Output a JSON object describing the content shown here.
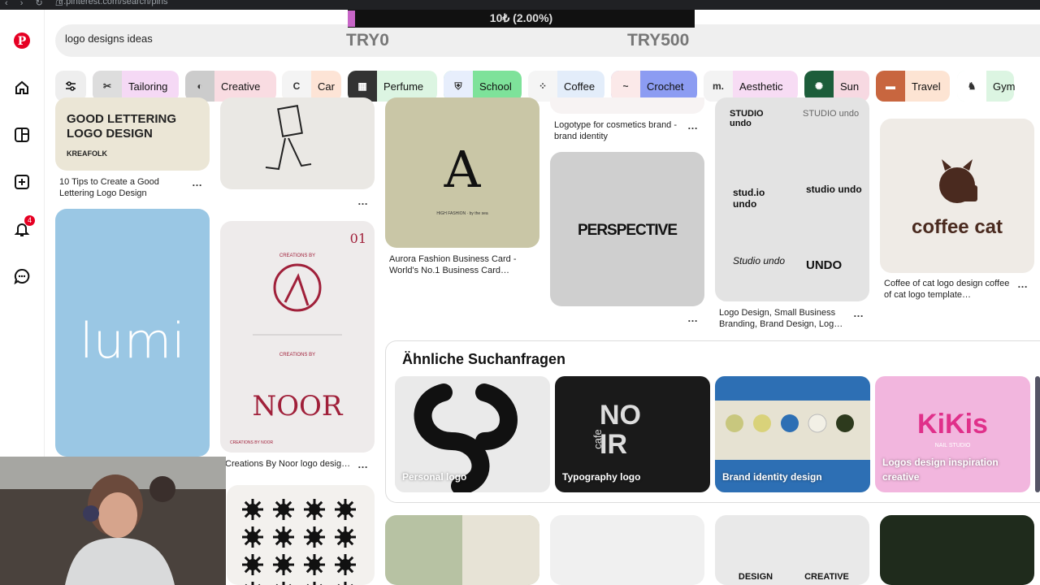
{
  "browser": {
    "url": "tr.pinterest.com/search/pins",
    "nav": "‹ › ↻ ☖"
  },
  "sidebar": {
    "items": [
      {
        "icon": "pinterest-logo-icon"
      },
      {
        "icon": "home-icon"
      },
      {
        "icon": "boards-icon"
      },
      {
        "icon": "create-icon"
      },
      {
        "icon": "notifications-icon",
        "badge": "4"
      },
      {
        "icon": "messages-icon"
      }
    ]
  },
  "search": {
    "value": "logo designs ideas"
  },
  "overlay": {
    "progress_text": "10₺ (2.00%)",
    "progress_fraction": 0.02,
    "min_label": "TRY0",
    "max_label": "TRY500"
  },
  "chips": [
    {
      "label": "Tailoring",
      "color": "#f5d9f5",
      "thumb_bg": "#ddd",
      "thumb": "✂"
    },
    {
      "label": "Creative",
      "color": "#f9dce2",
      "thumb_bg": "#ccc",
      "thumb": "◐"
    },
    {
      "label": "Car",
      "color": "#fde4d6",
      "thumb_bg": "#f4f4f4",
      "thumb": "C"
    },
    {
      "label": "Perfume",
      "color": "#dcf5e2",
      "thumb_bg": "#333",
      "thumb": "▦"
    },
    {
      "label": "School",
      "color": "#7ee29a",
      "thumb_bg": "#e7eefc",
      "thumb": "⛨"
    },
    {
      "label": "Coffee",
      "color": "#e3edfa",
      "thumb_bg": "#f5f5f5",
      "thumb": "⁘"
    },
    {
      "label": "Crochet",
      "color": "#8c9cf2",
      "thumb_bg": "#fbe9e9",
      "thumb": "~"
    },
    {
      "label": "Aesthetic",
      "color": "#f7dcf4",
      "thumb_bg": "#f3f3f3",
      "thumb": "m."
    },
    {
      "label": "Sun",
      "color": "#f7d9e2",
      "thumb_bg": "#1c5d3a",
      "thumb": "✺"
    },
    {
      "label": "Travel",
      "color": "#fde4d3",
      "thumb_bg": "#c8663f",
      "thumb": "▬"
    },
    {
      "label": "Gym",
      "color": "#dcf5e2",
      "thumb_bg": "#ffffff",
      "thumb": "♞"
    }
  ],
  "pins": {
    "lettering": {
      "title1": "GOOD LETTERING",
      "title2": "LOGO DESIGN",
      "brand": "KREAFOLK",
      "caption": "10 Tips to Create a Good Lettering Logo Design"
    },
    "lumi": {
      "text": "lumi"
    },
    "noor": {
      "label1": "CREATIONS BY",
      "number": "01",
      "label2": "CREATIONS BY",
      "word": "NOOR",
      "footer": "CREATIONS BY NOOR",
      "caption": "Creations By Noor logo desig…"
    },
    "aurora": {
      "small": "HIGH FASHION · by the sea",
      "caption": "Aurora Fashion Business Card - World's No.1 Business Card…"
    },
    "cosmetics": {
      "caption": "Logotype for cosmetics brand - brand identity"
    },
    "perspective": {
      "word": "PERSPECTIVE"
    },
    "studio": {
      "marks": [
        "STUDIO undo",
        "STUDIO undo",
        "stud.io undo",
        "studio undo",
        "Studio undo",
        "UNDO"
      ],
      "caption": "Logo Design, Small Business Branding, Brand Design, Log…"
    },
    "coffee": {
      "word": "coffee cat",
      "caption": "Coffee of cat logo design coffee of cat logo template…"
    },
    "design": {
      "w1": "DESIGN",
      "w2": "CREATIVE"
    }
  },
  "similar": {
    "title": "Ähnliche Suchanfragen",
    "items": [
      {
        "label": "Personal logo"
      },
      {
        "label": "Typography logo"
      },
      {
        "label": "Brand identity design"
      },
      {
        "label": "Logos design inspiration creative"
      }
    ]
  },
  "typo_card": {
    "letters": "NO IR",
    "cafe": "cafe"
  },
  "kiki": {
    "word": "KiKis",
    "sub": "NAIL STUDIO"
  },
  "colors": {
    "brand": "#e60023"
  }
}
